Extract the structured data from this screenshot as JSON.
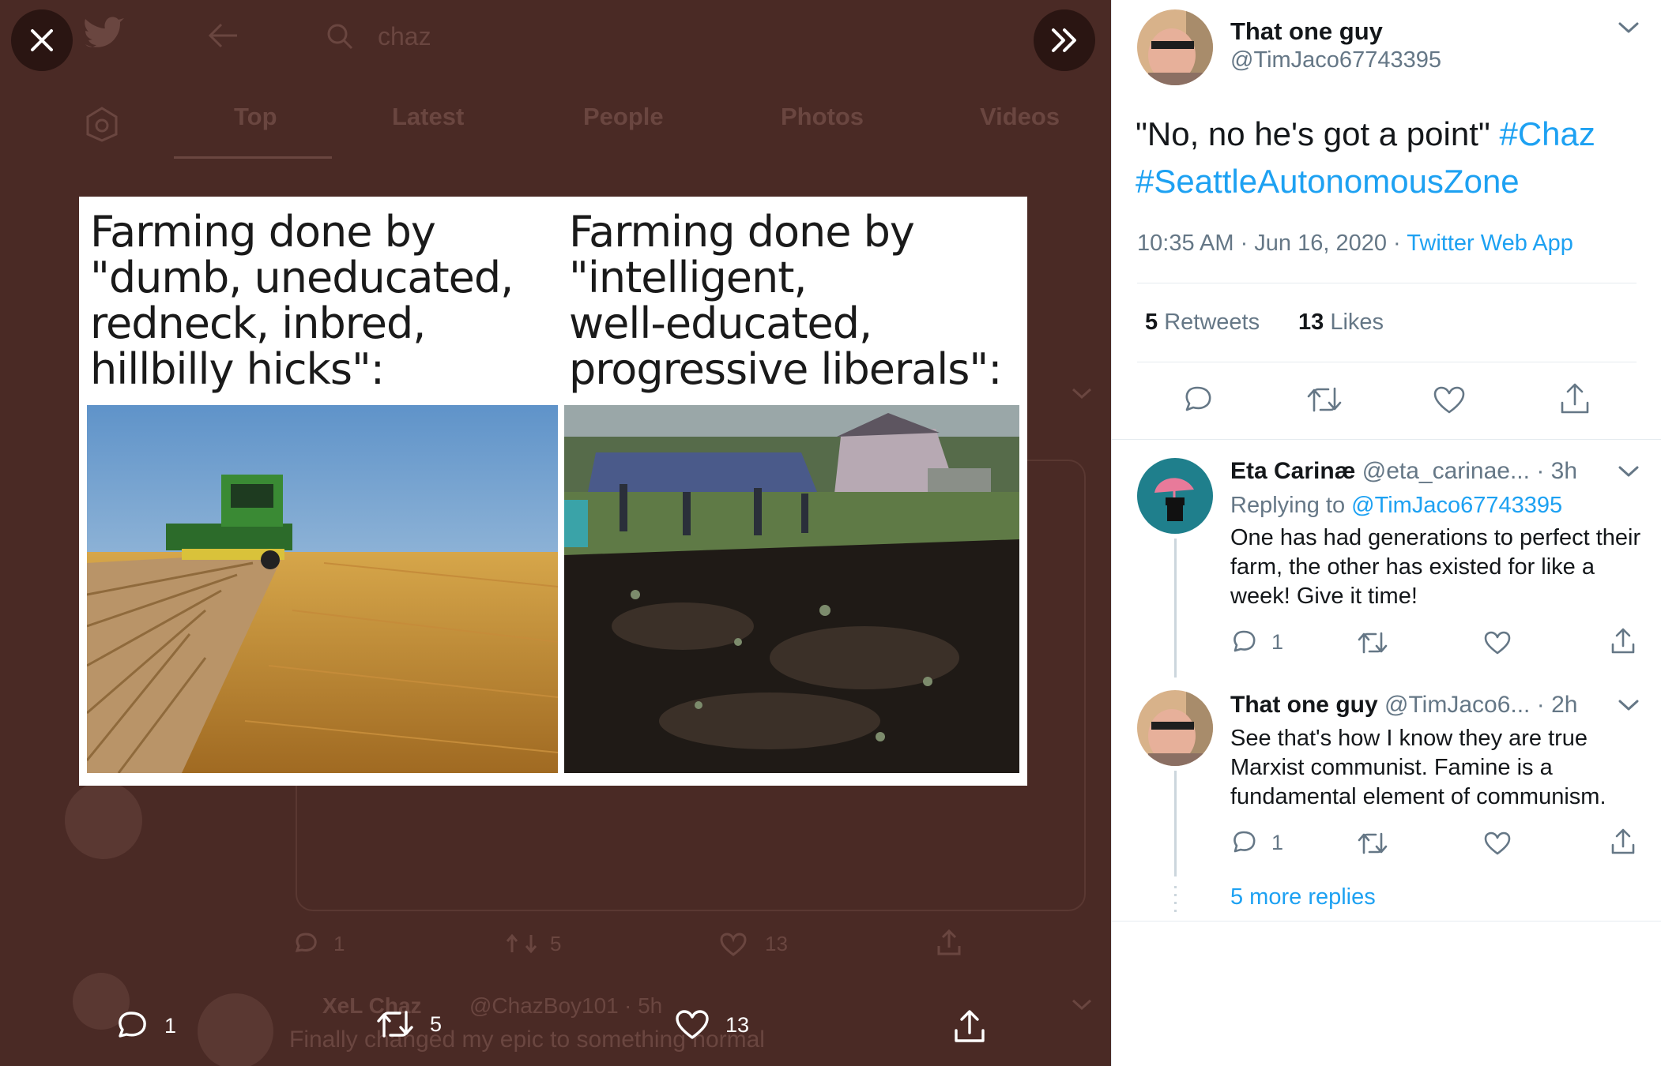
{
  "background_feed": {
    "search_query": "chaz",
    "tabs": [
      "Top",
      "Latest",
      "People",
      "Photos",
      "Videos"
    ],
    "ghost_counts": {
      "replies": "1",
      "retweets": "5",
      "likes": "13"
    },
    "ghost_tweet": {
      "name": "XeL Chaz",
      "handle": "@ChazBoy101",
      "time": "· 5h",
      "text": "Finally changed my epic to something normal"
    }
  },
  "viewer": {
    "meme": {
      "left_caption": "Farming done by\n\"dumb, uneducated,\nredneck, inbred,\nhillbilly hicks\":",
      "right_caption": "Farming done by\n\"intelligent,\nwell-educated,\nprogressive liberals\":"
    },
    "actions": {
      "replies": "1",
      "retweets": "5",
      "likes": "13"
    }
  },
  "tweet": {
    "name": "That one guy",
    "handle": "@TimJaco67743395",
    "text_quote": "\"No, no he's got a point\"",
    "hashtag1": "#Chaz",
    "hashtag2": "#SeattleAutonomousZone",
    "time": "10:35 AM · Jun 16, 2020 ·",
    "source": "Twitter Web App",
    "retweet_count": "5",
    "retweet_label": "Retweets",
    "like_count": "13",
    "like_label": "Likes"
  },
  "replies": [
    {
      "name": "Eta Carinæ",
      "handle": "@eta_carinae...",
      "time": "· 3h",
      "replying_prefix": "Replying to",
      "replying_to": "@TimJaco67743395",
      "text": "One has had generations to perfect their farm, the other has existed for like a week! Give it time!",
      "reply_count": "1"
    },
    {
      "name": "That one guy",
      "handle": "@TimJaco6...",
      "time": "· 2h",
      "text": "See that's how I know they are true Marxist communist. Famine is a fundamental element of communism.",
      "reply_count": "1"
    }
  ],
  "more_replies": "5 more replies",
  "colors": {
    "link": "#1da1f2",
    "overlay": "#4a2a25",
    "text": "#14171a",
    "muted": "#657786"
  }
}
